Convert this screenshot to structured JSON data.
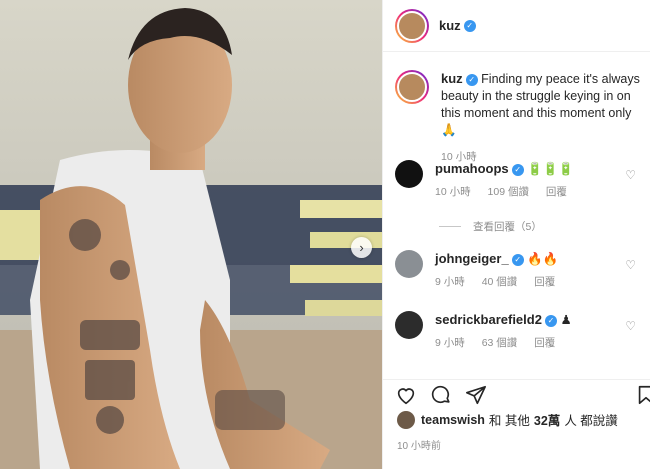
{
  "post": {
    "author": "kuz",
    "caption": "Finding my peace it's always beauty in the struggle keying in on this moment and this moment only",
    "caption_time": "10 小時",
    "likes_user": "teamswish",
    "likes_text_mid": "和 其他",
    "likes_count": "32萬",
    "likes_text_end": "人 都說讚",
    "posted_ago": "10 小時前"
  },
  "comments": [
    {
      "user": "pumahoops",
      "text": "",
      "emoji": "🔋🔋🔋",
      "time": "10 小時",
      "likes": "109 個讚",
      "reply": "回覆"
    },
    {
      "user": "johngeiger_",
      "text": "",
      "emoji": "🔥🔥",
      "time": "9 小時",
      "likes": "40 個讚",
      "reply": "回覆"
    },
    {
      "user": "sedrickbarefield2",
      "text": "",
      "emoji": "♟",
      "time": "9 小時",
      "likes": "63 個讚",
      "reply": "回覆"
    }
  ],
  "view_replies": "查看回覆（5）",
  "icons": {
    "verified": "✓",
    "heart": "♡",
    "next": "›"
  },
  "colors": {
    "verified": "#3897f0",
    "muted": "#8e8e8e"
  }
}
